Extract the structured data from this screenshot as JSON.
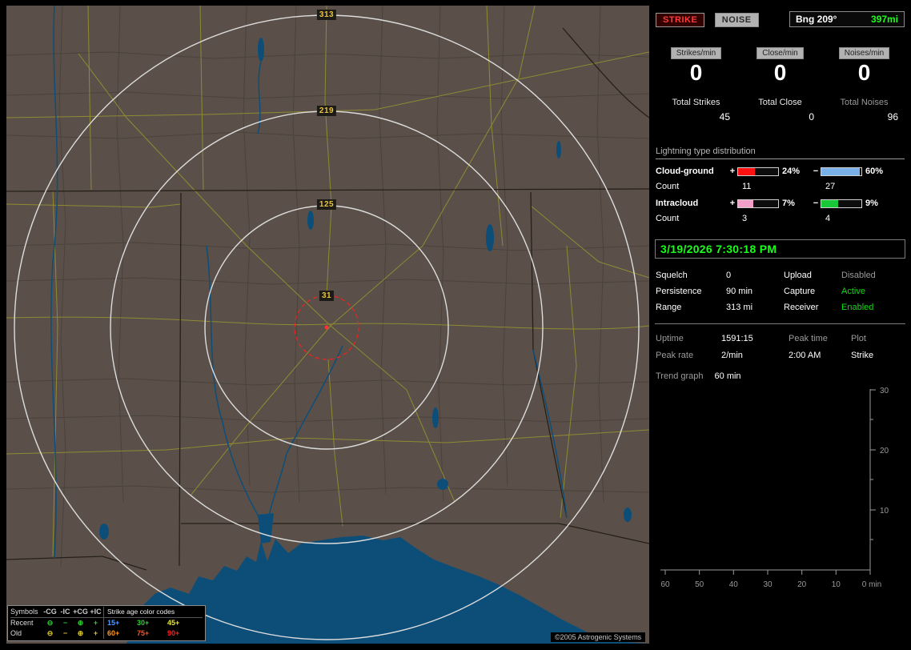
{
  "map": {
    "rings": [
      {
        "label": "313"
      },
      {
        "label": "219"
      },
      {
        "label": "125"
      },
      {
        "label": "31"
      }
    ],
    "copyright": "©2005 Astrogenic Systems"
  },
  "legend": {
    "symbols_header": "Symbols",
    "col_headers": [
      "-CG",
      "-IC",
      "+CG",
      "+IC"
    ],
    "age_header": "Strike age color codes",
    "rows": [
      {
        "label": "Recent",
        "color": "#2ecc2e",
        "symbols": [
          "⊖",
          "−",
          "⊕",
          "+"
        ],
        "ages": [
          {
            "t": "15+",
            "c": "#5599ff"
          },
          {
            "t": "30+",
            "c": "#33cc33"
          },
          {
            "t": "45+",
            "c": "#e8e832"
          }
        ]
      },
      {
        "label": "Old",
        "color": "#d8c52c",
        "symbols": [
          "⊖",
          "−",
          "⊕",
          "+"
        ],
        "ages": [
          {
            "t": "60+",
            "c": "#ff9922"
          },
          {
            "t": "75+",
            "c": "#ff5522"
          },
          {
            "t": "90+",
            "c": "#ff2222"
          }
        ]
      }
    ]
  },
  "panel": {
    "strike_btn": "STRIKE",
    "noise_btn": "NOISE",
    "bearing": "Bng 209°",
    "distance": "397mi",
    "counters": [
      {
        "label": "Strikes/min",
        "value": "0"
      },
      {
        "label": "Close/min",
        "value": "0"
      },
      {
        "label": "Noises/min",
        "value": "0"
      }
    ],
    "totals": [
      {
        "label": "Total Strikes",
        "value": "45"
      },
      {
        "label": "Total Close",
        "value": "0"
      },
      {
        "label": "Total Noises",
        "value": "96"
      }
    ],
    "distribution": {
      "title": "Lightning type distribution",
      "rows": [
        {
          "label": "Cloud-ground",
          "plus_sign": "+",
          "minus_sign": "−",
          "plus_pct": "24%",
          "minus_pct": "60%",
          "plus_fill": 42,
          "minus_fill": 95,
          "plus_color": "#ff1111",
          "minus_color": "#7ab0e8",
          "count_label": "Count",
          "plus_count": "11",
          "minus_count": "27"
        },
        {
          "label": "Intracloud",
          "plus_sign": "+",
          "minus_sign": "−",
          "plus_pct": "7%",
          "minus_pct": "9%",
          "plus_fill": 38,
          "minus_fill": 42,
          "plus_color": "#f2a0c8",
          "minus_color": "#18c838",
          "count_label": "Count",
          "plus_count": "3",
          "minus_count": "4"
        }
      ]
    },
    "datetime": "3/19/2026 7:30:18 PM",
    "status": {
      "squelch_label": "Squelch",
      "squelch": "0",
      "persistence_label": "Persistence",
      "persistence": "90 min",
      "range_label": "Range",
      "range": "313 mi",
      "upload_label": "Upload",
      "upload": "Disabled",
      "upload_color": "#9a9a9a",
      "capture_label": "Capture",
      "capture": "Active",
      "capture_color": "#11dd11",
      "receiver_label": "Receiver",
      "receiver": "Enabled",
      "receiver_color": "#11dd11"
    },
    "stats": {
      "uptime_label": "Uptime",
      "uptime": "1591:15",
      "peakrate_label": "Peak rate",
      "peakrate": "2/min",
      "peaktime_label": "Peak time",
      "peaktime": "2:00 AM",
      "plot_label": "Plot",
      "plot": "Strike"
    },
    "trend": {
      "label": "Trend graph",
      "window": "60 min",
      "y_ticks": [
        "30",
        "20",
        "10"
      ],
      "x_ticks": [
        "60",
        "50",
        "40",
        "30",
        "20",
        "10"
      ],
      "x_end": "0 min"
    }
  }
}
